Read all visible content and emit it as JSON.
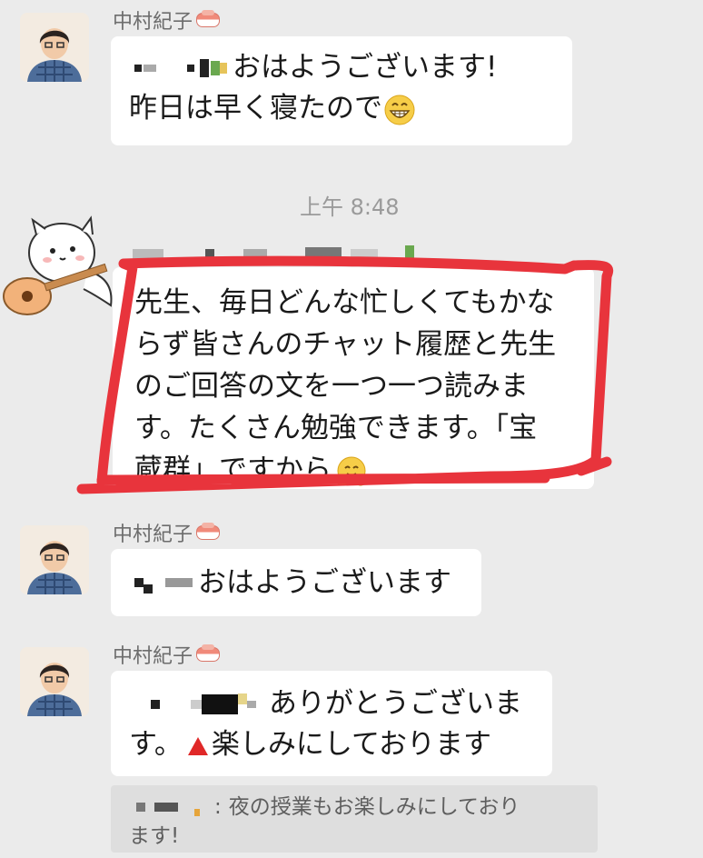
{
  "messages": [
    {
      "sender": "中村紀子",
      "text_line1": "おはようございます!",
      "text_line2": "昨日は早く寝たので"
    },
    {
      "text_line1": "先生、毎日どんな忙しくてもかな",
      "text_line2": "らず皆さんのチャット履歴と先生",
      "text_line3": "のご回答の文を一つ一つ読みま",
      "text_line4": "す。たくさん勉強できます。「宝",
      "text_line5": "蔵群」ですから"
    },
    {
      "sender": "中村紀子",
      "text": "おはようございます"
    },
    {
      "sender": "中村紀子",
      "text_line1": "ありがとうございま",
      "text_line2_prefix": "す。",
      "text_line2": "楽しみにしております"
    }
  ],
  "timestamp": "上午 8:48",
  "quote": {
    "text_line1": "夜の授業もお楽しみにしており",
    "text_line2": "ます!"
  },
  "colors": {
    "highlight_border": "#e8343c",
    "background": "#ebebeb",
    "bubble": "#ffffff"
  },
  "icons": [
    "grin-emoji",
    "hug-emoji",
    "red-triangle-emoji",
    "sushi-emoji",
    "cat-ukulele-sticker"
  ]
}
